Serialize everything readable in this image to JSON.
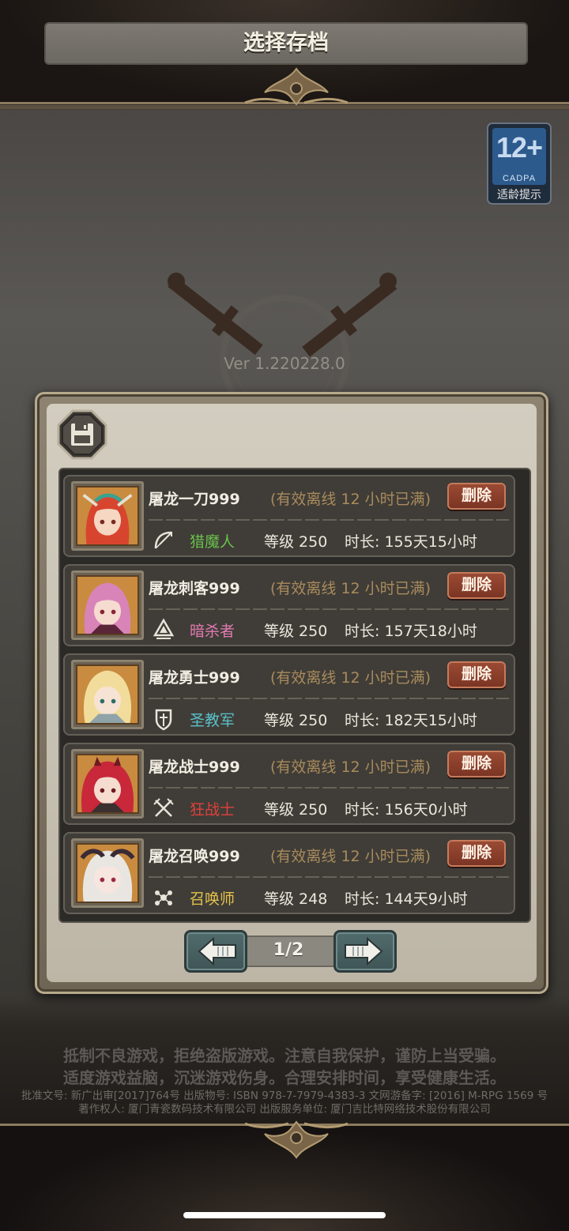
{
  "age_rating": {
    "number": "12+",
    "org": "CADPA",
    "tip": "适龄提示"
  },
  "version": "Ver 1.220228.0",
  "panel": {
    "title": "选择存档"
  },
  "slots": [
    {
      "name": "屠龙一刀999",
      "offline": "(有效离线 12 小时已满)",
      "delete_label": "删除",
      "class_name": "猎魔人",
      "class_color": "#69c14a",
      "class_icon": "bow-icon",
      "level": "等级 250",
      "duration": "时长: 155天15小时",
      "hair_color": "#d8452f"
    },
    {
      "name": "屠龙刺客999",
      "offline": "(有效离线 12 小时已满)",
      "delete_label": "删除",
      "class_name": "暗杀者",
      "class_color": "#e07ab1",
      "class_icon": "assassin-icon",
      "level": "等级 250",
      "duration": "时长: 157天18小时",
      "hair_color": "#d884b8"
    },
    {
      "name": "屠龙勇士999",
      "offline": "(有效离线 12 小时已满)",
      "delete_label": "删除",
      "class_name": "圣教军",
      "class_color": "#59c0c9",
      "class_icon": "crusader-shield-icon",
      "level": "等级 250",
      "duration": "时长: 182天15小时",
      "hair_color": "#f1dc9c"
    },
    {
      "name": "屠龙战士999",
      "offline": "(有效离线 12 小时已满)",
      "delete_label": "删除",
      "class_name": "狂战士",
      "class_color": "#e0403a",
      "class_icon": "crossed-swords-icon",
      "level": "等级 250",
      "duration": "时长: 156天0小时",
      "hair_color": "#c8283a"
    },
    {
      "name": "屠龙召唤999",
      "offline": "(有效离线 12 小时已满)",
      "delete_label": "删除",
      "class_name": "召唤师",
      "class_color": "#e5c24a",
      "class_icon": "summoner-icon",
      "level": "等级 248",
      "duration": "时长: 144天9小时",
      "hair_color": "#e9e6e2"
    }
  ],
  "pagination": {
    "page": "1/2"
  },
  "notices": {
    "line1": "抵制不良游戏，拒绝盗版游戏。注意自我保护，谨防上当受骗。",
    "line2": "适度游戏益脑，沉迷游戏伤身。合理安排时间，享受健康生活。",
    "line3": "批准文号: 新广出审[2017]764号 出版物号: ISBN 978-7-7979-4383-3 文网游备字: [2016] M-RPG 1569 号",
    "line4": "著作权人: 厦门青瓷数码技术有限公司 出版服务单位: 厦门吉比特网络技术股份有限公司"
  }
}
